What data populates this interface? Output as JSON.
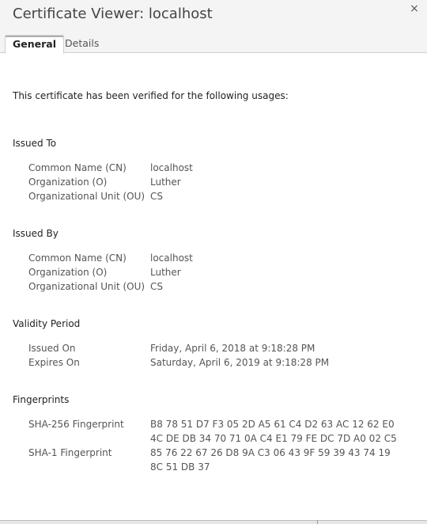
{
  "window": {
    "title": "Certificate Viewer: localhost",
    "close_glyph": "×"
  },
  "tabs": [
    {
      "label": "General",
      "selected": true
    },
    {
      "label": "Details",
      "selected": false
    }
  ],
  "verification_text": "This certificate has been verified for the following usages:",
  "issued_to": {
    "heading": "Issued To",
    "rows": [
      {
        "label": "Common Name (CN)",
        "value": "localhost"
      },
      {
        "label": "Organization (O)",
        "value": "Luther"
      },
      {
        "label": "Organizational Unit (OU)",
        "value": "CS"
      }
    ]
  },
  "issued_by": {
    "heading": "Issued By",
    "rows": [
      {
        "label": "Common Name (CN)",
        "value": "localhost"
      },
      {
        "label": "Organization (O)",
        "value": "Luther"
      },
      {
        "label": "Organizational Unit (OU)",
        "value": "CS"
      }
    ]
  },
  "validity": {
    "heading": "Validity Period",
    "rows": [
      {
        "label": "Issued On",
        "value": "Friday, April 6, 2018 at 9:18:28 PM"
      },
      {
        "label": "Expires On",
        "value": "Saturday, April 6, 2019 at 9:18:28 PM"
      }
    ]
  },
  "fingerprints": {
    "heading": "Fingerprints",
    "sha256": {
      "label": "SHA-256 Fingerprint",
      "line1": "B8 78 51 D7 F3 05 2D A5 61 C4 D2 63 AC 12 62 E0",
      "line2": "4C DE DB 34 70 71 0A C4 E1 79 FE DC 7D A0 02 C5"
    },
    "sha1": {
      "label": "SHA-1 Fingerprint",
      "line1": "85 76 22 67 26 D8 9A C3 06 43 9F 59 39 43 74 19",
      "line2": "8C 51 DB 37"
    }
  }
}
